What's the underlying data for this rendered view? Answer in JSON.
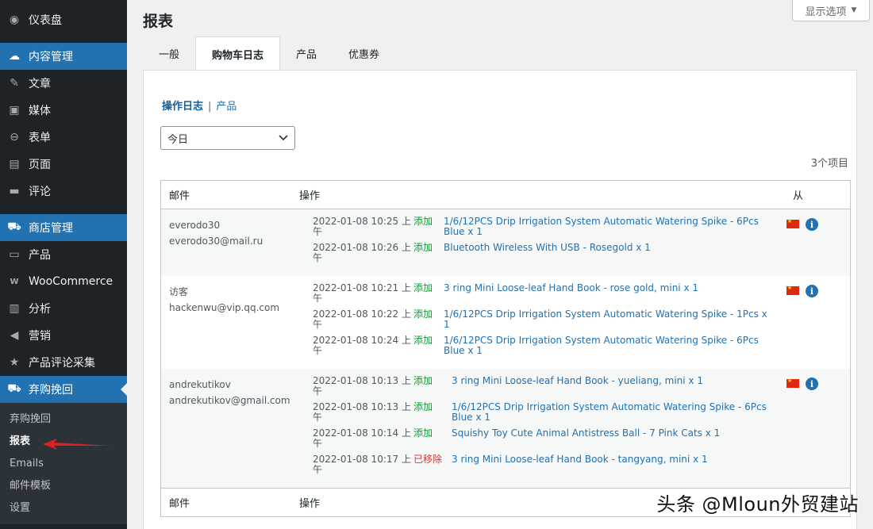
{
  "sidebar": {
    "items": [
      {
        "label": "仪表盘",
        "icon": "dashboard-icon",
        "glyph": "◉"
      },
      {
        "label": "内容管理",
        "icon": "cloud-icon",
        "glyph": "☁",
        "current": true
      },
      {
        "label": "文章",
        "icon": "pin-icon",
        "glyph": "✎"
      },
      {
        "label": "媒体",
        "icon": "media-icon",
        "glyph": "▣"
      },
      {
        "label": "表单",
        "icon": "form-icon",
        "glyph": "⊖"
      },
      {
        "label": "页面",
        "icon": "page-icon",
        "glyph": "▤"
      },
      {
        "label": "评论",
        "icon": "comment-icon",
        "glyph": "▬"
      },
      {
        "label": "商店管理",
        "icon": "cart-icon",
        "glyph": "🛒",
        "current": true
      },
      {
        "label": "产品",
        "icon": "archive-icon",
        "glyph": "▭"
      },
      {
        "label": "WooCommerce",
        "icon": "woo-icon",
        "glyph": "W"
      },
      {
        "label": "分析",
        "icon": "chart-bar-icon",
        "glyph": "▥"
      },
      {
        "label": "营销",
        "icon": "megaphone-icon",
        "glyph": "◀"
      },
      {
        "label": "产品评论采集",
        "icon": "star-icon",
        "glyph": "★"
      },
      {
        "label": "弃购挽回",
        "icon": "cart-icon",
        "glyph": "🛒",
        "current": true
      }
    ],
    "submenu": [
      {
        "label": "弃购挽回"
      },
      {
        "label": "报表",
        "current": true
      },
      {
        "label": "Emails"
      },
      {
        "label": "邮件模板"
      },
      {
        "label": "设置"
      }
    ]
  },
  "header": {
    "title": "报表",
    "screen_options": "显示选项"
  },
  "tabs": [
    "一般",
    "购物车日志",
    "产品",
    "优惠券"
  ],
  "subnav": {
    "current": "操作日志",
    "separator": "|",
    "other": "产品"
  },
  "filter": {
    "selected": "今日"
  },
  "count": "3个项目",
  "table": {
    "headers": {
      "email": "邮件",
      "action": "操作",
      "from": "从"
    },
    "rows": [
      {
        "name": "everodo30",
        "email": "everodo30@mail.ru",
        "actions": [
          {
            "time": "2022-01-08 10:25 上午",
            "type": "添加",
            "product": "1/6/12PCS Drip Irrigation System Automatic Watering Spike - 6Pcs Blue",
            "qty": "x 1"
          },
          {
            "time": "2022-01-08 10:26 上午",
            "type": "添加",
            "product": "Bluetooth Wireless With USB - Rosegold",
            "qty": "x 1"
          }
        ]
      },
      {
        "name": "访客",
        "email": "hackenwu@vip.qq.com",
        "actions": [
          {
            "time": "2022-01-08 10:21 上午",
            "type": "添加",
            "product": "3 ring Mini Loose-leaf Hand Book - rose gold, mini",
            "qty": "x 1"
          },
          {
            "time": "2022-01-08 10:22 上午",
            "type": "添加",
            "product": "1/6/12PCS Drip Irrigation System Automatic Watering Spike - 1Pcs",
            "qty": "x 1"
          },
          {
            "time": "2022-01-08 10:24 上午",
            "type": "添加",
            "product": "1/6/12PCS Drip Irrigation System Automatic Watering Spike - 6Pcs Blue",
            "qty": "x 1"
          }
        ]
      },
      {
        "name": "andrekutikov",
        "email": "andrekutikov@gmail.com",
        "actions": [
          {
            "time": "2022-01-08 10:13 上午",
            "type": "添加",
            "product": "3 ring Mini Loose-leaf Hand Book - yueliang, mini",
            "qty": "x 1"
          },
          {
            "time": "2022-01-08 10:13 上午",
            "type": "添加",
            "product": "1/6/12PCS Drip Irrigation System Automatic Watering Spike - 6Pcs Blue",
            "qty": "x 1"
          },
          {
            "time": "2022-01-08 10:14 上午",
            "type": "添加",
            "product": "Squishy Toy Cute Animal Antistress Ball - 7 Pink Cats",
            "qty": "x 1"
          },
          {
            "time": "2022-01-08 10:17 上午",
            "type": "已移除",
            "product": "3 ring Mini Loose-leaf Hand Book - tangyang, mini",
            "qty": "x 1",
            "removed": true
          }
        ]
      }
    ]
  },
  "watermark": "头条 @Mloun外贸建站",
  "colors": {
    "accent": "#2271b1",
    "sidebar_bg": "#1d2327",
    "added": "#00a32a",
    "removed": "#d63638"
  }
}
